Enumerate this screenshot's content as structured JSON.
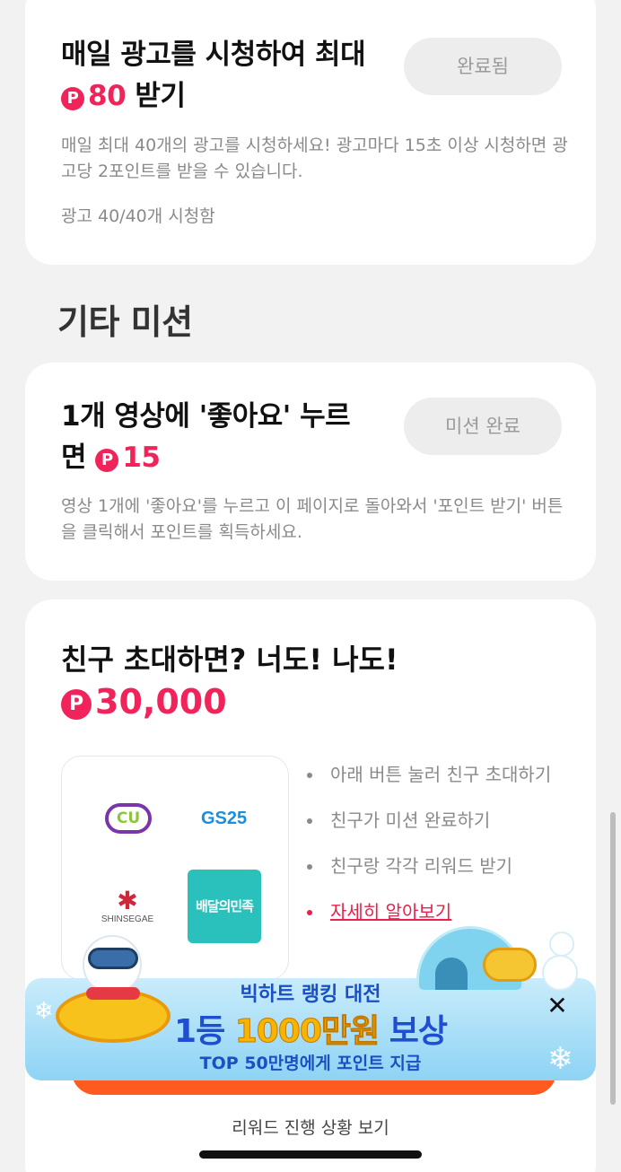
{
  "daily_ad_mission": {
    "title_prefix": "매일 광고를 시청하여 최대 ",
    "point_symbol": "P",
    "points": "80",
    "title_suffix": " 받기",
    "button_label": "완료됨",
    "description": "매일 최대 40개의 광고를 시청하세요! 광고마다 15초 이상 시청하면 광고당 2포인트를 받을 수 있습니다.",
    "progress": "광고 40/40개 시청함"
  },
  "section_title": "기타 미션",
  "like_mission": {
    "title_prefix": "1개 영상에 '좋아요' 누르면 ",
    "point_symbol": "P",
    "points": "15",
    "button_label": "미션 완료",
    "description": "영상 1개에 '좋아요'를 누르고 이 페이지로 돌아와서 '포인트 받기' 버튼을 클릭해서 포인트를 획득하세요."
  },
  "invite": {
    "title": "친구 초대하면? 너도! 나도!",
    "point_symbol": "P",
    "amount": "30,000",
    "logos": {
      "cu": "CU",
      "gs25": "GS25",
      "shinsegae": "SHINSEGAE",
      "baemin": "배달의민족"
    },
    "steps": [
      "아래 버튼 눌러 친구 초대하기",
      "친구가 미션 완료하기",
      "친구랑 각각 리워드 받기"
    ],
    "learn_more": "자세히 알아보기",
    "footer_link": "리워드 진행 상황 보기"
  },
  "banner": {
    "line1": "빅하트 랭킹 대전",
    "line2_a": "1등 ",
    "line2_gold": "1000만원",
    "line2_b": " 보상",
    "line3": "TOP 50만명에게 포인트 지급",
    "close_glyph": "✕"
  },
  "colors": {
    "accent": "#f0245a",
    "pill_bg": "#ededed",
    "cta": "#ff5a1f"
  }
}
